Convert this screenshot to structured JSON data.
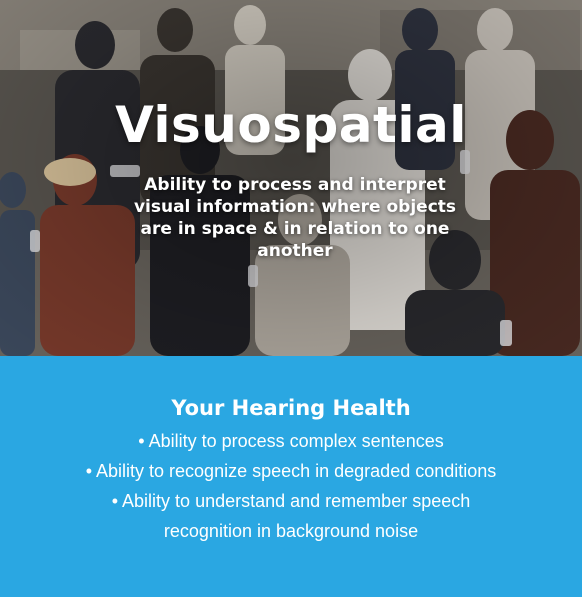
{
  "hero": {
    "title": "Visuospatial",
    "subtitle": "Ability to process and interpret visual information: where objects are in space & in relation to one another"
  },
  "panel": {
    "title": "Your Hearing Health",
    "bullets": [
      "• Ability to process complex sentences",
      "• Ability to recognize speech in degraded conditions",
      "• Ability to understand and remember speech recognition in background noise"
    ],
    "background_color": "#2aa7e2"
  }
}
